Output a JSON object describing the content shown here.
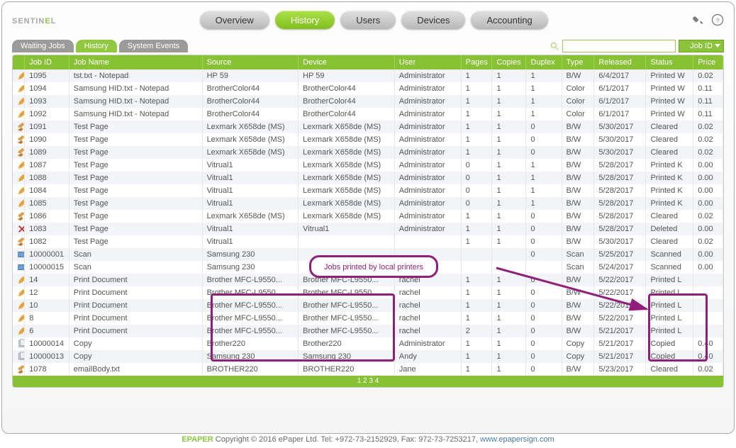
{
  "app": {
    "logoText1": "SENTIN",
    "logoText2": "E",
    "logoText3": "L"
  },
  "nav": [
    {
      "label": "Overview",
      "active": false
    },
    {
      "label": "History",
      "active": true
    },
    {
      "label": "Users",
      "active": false
    },
    {
      "label": "Devices",
      "active": false
    },
    {
      "label": "Accounting",
      "active": false
    }
  ],
  "subtabs": [
    {
      "label": "Waiting Jobs",
      "active": false
    },
    {
      "label": "History",
      "active": true
    },
    {
      "label": "System Events",
      "active": false
    }
  ],
  "search": {
    "value": "",
    "field": "Job ID"
  },
  "columns": [
    "",
    "Job ID",
    "Job Name",
    "Source",
    "Device",
    "User",
    "Pages",
    "Copies",
    "Duplex",
    "Type",
    "Released",
    "Status",
    "Price"
  ],
  "rows": [
    {
      "icon": "pencil",
      "id": "1095",
      "name": "tst.txt - Notepad",
      "source": "HP 59",
      "device": "HP 59",
      "user": "Administrator",
      "pages": "1",
      "copies": "1",
      "duplex": "1",
      "type": "B/W",
      "released": "6/4/2017",
      "status": "Printed W",
      "price": "0.02"
    },
    {
      "icon": "pencil",
      "id": "1094",
      "name": "Samsung HID.txt - Notepad",
      "source": "BrotherColor44",
      "device": "BrotherColor44",
      "user": "Administrator",
      "pages": "1",
      "copies": "1",
      "duplex": "1",
      "type": "Color",
      "released": "6/1/2017",
      "status": "Printed W",
      "price": "0.11"
    },
    {
      "icon": "pencil",
      "id": "1093",
      "name": "Samsung HID.txt - Notepad",
      "source": "BrotherColor44",
      "device": "BrotherColor44",
      "user": "Administrator",
      "pages": "1",
      "copies": "1",
      "duplex": "1",
      "type": "Color",
      "released": "6/1/2017",
      "status": "Printed W",
      "price": "0.11"
    },
    {
      "icon": "pencil",
      "id": "1092",
      "name": "Samsung HID.txt - Notepad",
      "source": "BrotherColor44",
      "device": "BrotherColor44",
      "user": "Administrator",
      "pages": "1",
      "copies": "1",
      "duplex": "1",
      "type": "Color",
      "released": "6/1/2017",
      "status": "Printed W",
      "price": "0.11"
    },
    {
      "icon": "broom",
      "id": "1091",
      "name": "Test Page",
      "source": "Lexmark X658de (MS)",
      "device": "Lexmark X658de (MS)",
      "user": "Administrator",
      "pages": "1",
      "copies": "1",
      "duplex": "0",
      "type": "B/W",
      "released": "5/30/2017",
      "status": "Cleared",
      "price": "0.02"
    },
    {
      "icon": "broom",
      "id": "1090",
      "name": "Test Page",
      "source": "Lexmark X658de (MS)",
      "device": "Lexmark X658de (MS)",
      "user": "Administrator",
      "pages": "1",
      "copies": "1",
      "duplex": "0",
      "type": "B/W",
      "released": "5/30/2017",
      "status": "Cleared",
      "price": "0.02"
    },
    {
      "icon": "broom",
      "id": "1089",
      "name": "Test Page",
      "source": "Lexmark X658de (MS)",
      "device": "Lexmark X658de (MS)",
      "user": "Administrator",
      "pages": "1",
      "copies": "1",
      "duplex": "0",
      "type": "B/W",
      "released": "5/30/2017",
      "status": "Cleared",
      "price": "0.02"
    },
    {
      "icon": "pencil",
      "id": "1087",
      "name": "Test Page",
      "source": "Vitrual1",
      "device": "Lexmark X658de (MS)",
      "user": "Administrator",
      "pages": "0",
      "copies": "1",
      "duplex": "1",
      "type": "B/W",
      "released": "5/28/2017",
      "status": "Printed K",
      "price": "0.00"
    },
    {
      "icon": "pencil",
      "id": "1088",
      "name": "Test Page",
      "source": "Vitrual1",
      "device": "Lexmark X658de (MS)",
      "user": "Administrator",
      "pages": "0",
      "copies": "1",
      "duplex": "1",
      "type": "B/W",
      "released": "5/28/2017",
      "status": "Printed K",
      "price": "0.00"
    },
    {
      "icon": "pencil",
      "id": "1084",
      "name": "Test Page",
      "source": "Vitrual1",
      "device": "Lexmark X658de (MS)",
      "user": "Administrator",
      "pages": "0",
      "copies": "1",
      "duplex": "1",
      "type": "B/W",
      "released": "5/28/2017",
      "status": "Printed K",
      "price": "0.00"
    },
    {
      "icon": "pencil",
      "id": "1085",
      "name": "Test Page",
      "source": "Vitrual1",
      "device": "Lexmark X658de (MS)",
      "user": "Administrator",
      "pages": "0",
      "copies": "1",
      "duplex": "1",
      "type": "B/W",
      "released": "5/28/2017",
      "status": "Printed K",
      "price": "0.00"
    },
    {
      "icon": "broom",
      "id": "1086",
      "name": "Test Page",
      "source": "Lexmark X658de (MS)",
      "device": "Lexmark X658de (MS)",
      "user": "Administrator",
      "pages": "1",
      "copies": "1",
      "duplex": "0",
      "type": "B/W",
      "released": "5/28/2017",
      "status": "Cleared",
      "price": "0.02"
    },
    {
      "icon": "delete",
      "id": "1083",
      "name": "Test Page",
      "source": "Vitrual1",
      "device": "Vitrual1",
      "user": "Administrator",
      "pages": "1",
      "copies": "1",
      "duplex": "0",
      "type": "B/W",
      "released": "5/28/2017",
      "status": "Deleted",
      "price": "0.00"
    },
    {
      "icon": "broom",
      "id": "1082",
      "name": "Test Page",
      "source": "Vitrual1",
      "device": "",
      "user": "",
      "pages": "1",
      "copies": "1",
      "duplex": "0",
      "type": "B/W",
      "released": "5/30/2017",
      "status": "Cleared",
      "price": "0.02"
    },
    {
      "icon": "scan",
      "id": "10000001",
      "name": "Scan",
      "source": "Samsung 230",
      "device": "",
      "user": "",
      "pages": "",
      "copies": "",
      "duplex": "0",
      "type": "Scan",
      "released": "5/25/2017",
      "status": "Scanned",
      "price": "0.00"
    },
    {
      "icon": "scan",
      "id": "10000015",
      "name": "Scan",
      "source": "Samsung 230",
      "device": "",
      "user": "",
      "pages": "",
      "copies": "",
      "duplex": "",
      "type": "Scan",
      "released": "5/24/2017",
      "status": "Scanned",
      "price": "0.00"
    },
    {
      "icon": "pencil",
      "id": "14",
      "name": "Print Document",
      "source": "Brother MFC-L9550...",
      "device": "Brother MFC-L9550...",
      "user": "rachel",
      "pages": "1",
      "copies": "1",
      "duplex": "0",
      "type": "B/W",
      "released": "5/22/2017",
      "status": "Printed L",
      "price": ""
    },
    {
      "icon": "pencil",
      "id": "12",
      "name": "Print Document",
      "source": "Brother MFC-L9550...",
      "device": "Brother MFC-L9550...",
      "user": "rachel",
      "pages": "1",
      "copies": "1",
      "duplex": "0",
      "type": "B/W",
      "released": "5/22/2017",
      "status": "Printed L",
      "price": ""
    },
    {
      "icon": "pencil",
      "id": "10",
      "name": "Print Document",
      "source": "Brother MFC-L9550...",
      "device": "Brother MFC-L9550...",
      "user": "rachel",
      "pages": "1",
      "copies": "1",
      "duplex": "0",
      "type": "B/W",
      "released": "5/22/2017",
      "status": "Printed L",
      "price": ""
    },
    {
      "icon": "pencil",
      "id": "8",
      "name": "Print Document",
      "source": "Brother MFC-L9550...",
      "device": "Brother MFC-L9550...",
      "user": "rachel",
      "pages": "1",
      "copies": "1",
      "duplex": "0",
      "type": "B/W",
      "released": "5/22/2017",
      "status": "Printed L",
      "price": ""
    },
    {
      "icon": "pencil",
      "id": "6",
      "name": "Print Document",
      "source": "Brother MFC-L9550...",
      "device": "Brother MFC-L9550...",
      "user": "rachel",
      "pages": "2",
      "copies": "1",
      "duplex": "0",
      "type": "B/W",
      "released": "5/21/2017",
      "status": "Printed L",
      "price": ""
    },
    {
      "icon": "copy",
      "id": "10000014",
      "name": "Copy",
      "source": "Brother220",
      "device": "Brother220",
      "user": "Administrator",
      "pages": "1",
      "copies": "1",
      "duplex": "0",
      "type": "Copy",
      "released": "5/21/2017",
      "status": "Copied",
      "price": "0.40"
    },
    {
      "icon": "copy",
      "id": "10000013",
      "name": "Copy",
      "source": "Samsung 230",
      "device": "Samsung 230",
      "user": "Andy",
      "pages": "1",
      "copies": "1",
      "duplex": "0",
      "type": "Copy",
      "released": "5/21/2017",
      "status": "Copied",
      "price": "0.40"
    },
    {
      "icon": "broom",
      "id": "1078",
      "name": "emailBody.txt",
      "source": "BROTHER220",
      "device": "BROTHER220",
      "user": "Jane",
      "pages": "1",
      "copies": "1",
      "duplex": "0",
      "type": "B/W",
      "released": "5/23/2017",
      "status": "Cleared",
      "price": "0.02"
    }
  ],
  "pager": {
    "text": "1 2 3 4"
  },
  "footer": {
    "brand": "EPAPER",
    "copyright": "Copyright © 2016 ePaper Ltd. Tel: +972-73-2152929, Fax: 972-73-7253217,",
    "link": "www.epapersign.com"
  },
  "annotation": {
    "text": "Jobs printed by local printers"
  }
}
